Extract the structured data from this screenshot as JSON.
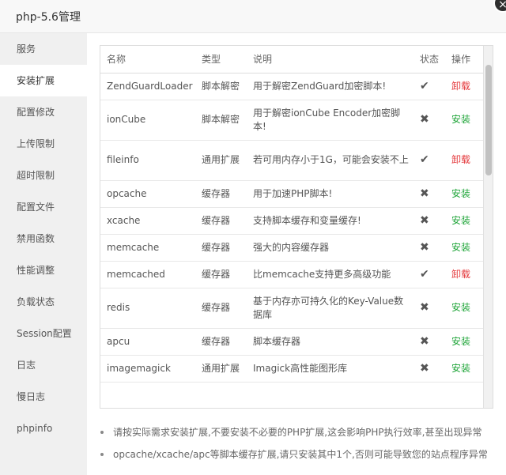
{
  "window": {
    "title": "php-5.6管理",
    "close_icon": "×"
  },
  "sidebar": {
    "items": [
      {
        "label": "服务"
      },
      {
        "label": "安装扩展",
        "active": true
      },
      {
        "label": "配置修改"
      },
      {
        "label": "上传限制"
      },
      {
        "label": "超时限制"
      },
      {
        "label": "配置文件"
      },
      {
        "label": "禁用函数"
      },
      {
        "label": "性能调整"
      },
      {
        "label": "负载状态"
      },
      {
        "label": "Session配置"
      },
      {
        "label": "日志"
      },
      {
        "label": "慢日志"
      },
      {
        "label": "phpinfo"
      }
    ]
  },
  "table": {
    "headers": {
      "name": "名称",
      "type": "类型",
      "desc": "说明",
      "status": "状态",
      "action": "操作"
    },
    "rows": [
      {
        "name": "ZendGuardLoader",
        "type": "脚本解密",
        "desc": "用于解密ZendGuard加密脚本!",
        "status": "✔",
        "action": "卸载",
        "installed": true
      },
      {
        "name": "ionCube",
        "type": "脚本解密",
        "desc": "用于解密ionCube Encoder加密脚本!",
        "status": "✖",
        "action": "安装",
        "installed": false
      },
      {
        "name": "fileinfo",
        "type": "通用扩展",
        "desc": "若可用内存小于1G，可能会安装不上",
        "status": "✔",
        "action": "卸载",
        "installed": true
      },
      {
        "name": "opcache",
        "type": "缓存器",
        "desc": "用于加速PHP脚本!",
        "status": "✖",
        "action": "安装",
        "installed": false
      },
      {
        "name": "xcache",
        "type": "缓存器",
        "desc": "支持脚本缓存和变量缓存!",
        "status": "✖",
        "action": "安装",
        "installed": false
      },
      {
        "name": "memcache",
        "type": "缓存器",
        "desc": "强大的内容缓存器",
        "status": "✖",
        "action": "安装",
        "installed": false
      },
      {
        "name": "memcached",
        "type": "缓存器",
        "desc": "比memcache支持更多高级功能",
        "status": "✔",
        "action": "卸载",
        "installed": true
      },
      {
        "name": "redis",
        "type": "缓存器",
        "desc": "基于内存亦可持久化的Key-Value数据库",
        "status": "✖",
        "action": "安装",
        "installed": false
      },
      {
        "name": "apcu",
        "type": "缓存器",
        "desc": "脚本缓存器",
        "status": "✖",
        "action": "安装",
        "installed": false
      },
      {
        "name": "imagemagick",
        "type": "通用扩展",
        "desc": "Imagick高性能图形库",
        "status": "✖",
        "action": "安装",
        "installed": false
      }
    ]
  },
  "tips": [
    "请按实际需求安装扩展,不要安装不必要的PHP扩展,这会影响PHP执行效率,甚至出现异常",
    "opcache/xcache/apc等脚本缓存扩展,请只安装其中1个,否则可能导致您的站点程序异常"
  ],
  "colors": {
    "uninstall": "#e4393c",
    "install": "#20a53a",
    "sidebar_bg": "#f0f0f0"
  }
}
